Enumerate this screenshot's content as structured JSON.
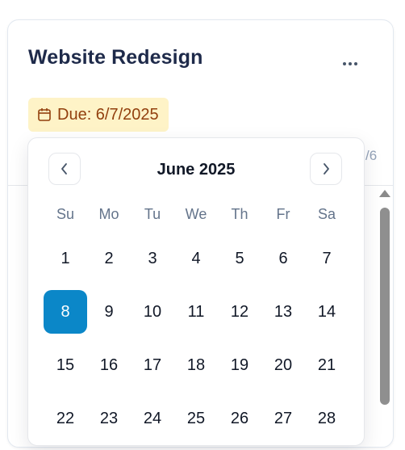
{
  "card": {
    "title": "Website Redesign",
    "more_label": "...",
    "due_label": "Due: 6/7/2025",
    "side_text": "/6"
  },
  "calendar": {
    "month_label": "June 2025",
    "weekdays": [
      "Su",
      "Mo",
      "Tu",
      "We",
      "Th",
      "Fr",
      "Sa"
    ],
    "days": [
      "1",
      "2",
      "3",
      "4",
      "5",
      "6",
      "7",
      "8",
      "9",
      "10",
      "11",
      "12",
      "13",
      "14",
      "15",
      "16",
      "17",
      "18",
      "19",
      "20",
      "21",
      "22",
      "23",
      "24",
      "25",
      "26",
      "27",
      "28"
    ],
    "selected_day": "8",
    "selected_color": "#0b87c8"
  },
  "icons": {
    "more": "more-dots-icon",
    "calendar": "calendar-icon",
    "prev": "chevron-left-icon",
    "next": "chevron-right-icon"
  },
  "colors": {
    "badge_bg": "#fef3c7",
    "badge_text": "#92400e",
    "title": "#1e2a4a"
  }
}
